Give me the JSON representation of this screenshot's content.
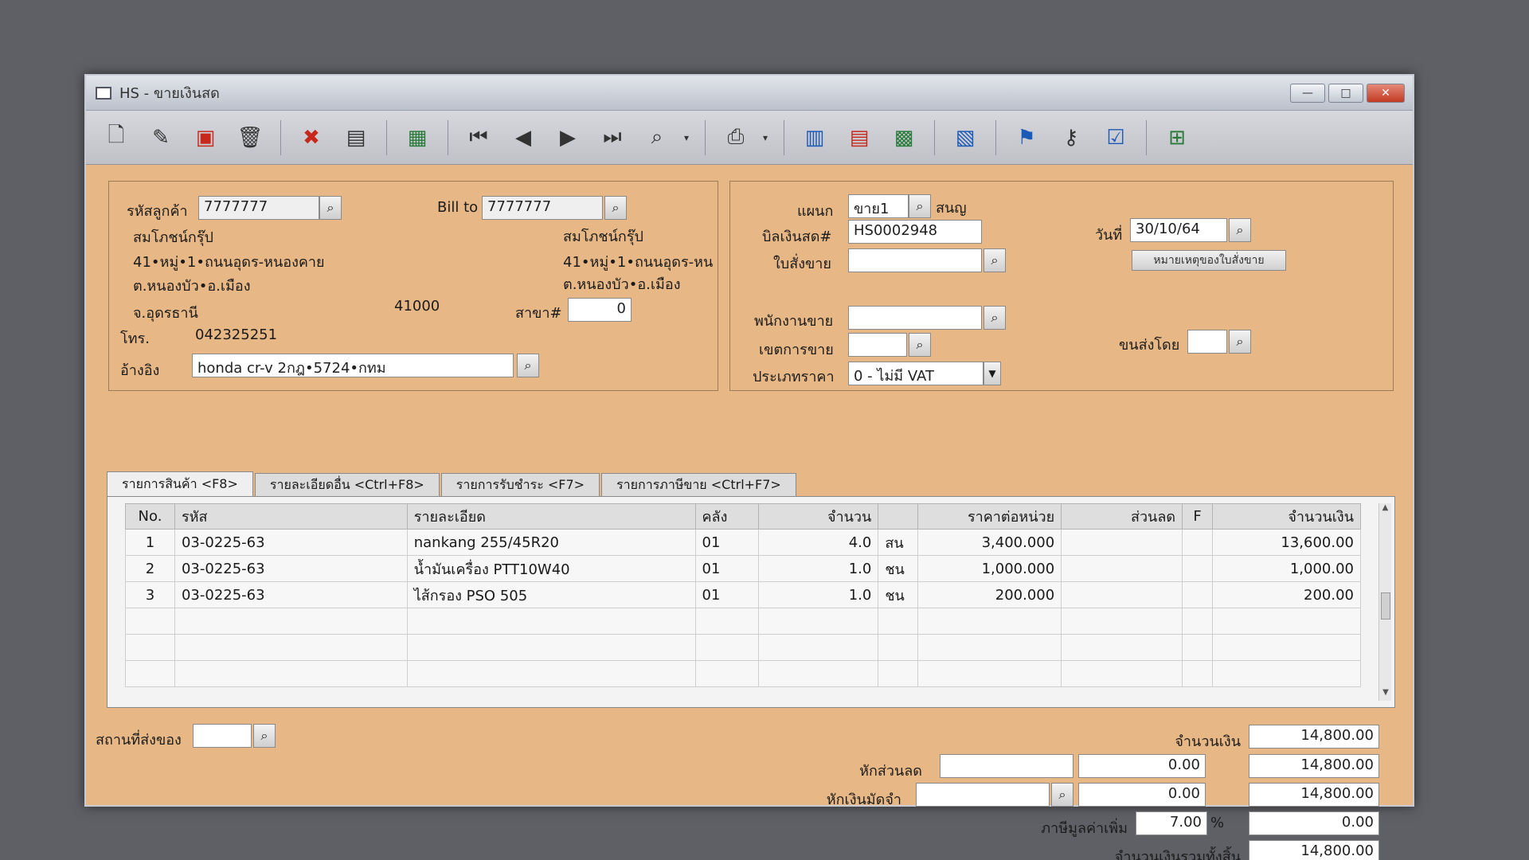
{
  "window": {
    "title": "HS - ขายเงินสด"
  },
  "window_controls": {
    "minimize": "—",
    "maximize": "□",
    "close": "✕"
  },
  "customer": {
    "code_label": "รหัสลูกค้า",
    "code": "7777777",
    "name": "สมโภชน์กรุ๊ป",
    "address1": "41•หมู่•1•ถนนอุดร-หนองคาย",
    "address2": "ต.หนองบัว•อ.เมือง",
    "address3": "จ.อุดรธานี",
    "postcode": "41000",
    "phone_label": "โทร.",
    "phone": "042325251",
    "ref_label": "อ้างอิง",
    "ref": "honda cr-v 2กฎ•5724•กทม"
  },
  "bill_to": {
    "label": "Bill to",
    "code": "7777777",
    "name": "สมโภชน์กรุ๊ป",
    "address1": "41•หมู่•1•ถนนอุดร-หน",
    "address2": "ต.หนองบัว•อ.เมือง",
    "branch_label": "สาขา#",
    "branch": "0"
  },
  "doc": {
    "dept_label": "แผนก",
    "dept": "ขาย1",
    "dept_name": "สนญ",
    "bill_no_label": "บิลเงินสด#",
    "bill_no": "HS0002948",
    "date_label": "วันที่",
    "date": "30/10/64",
    "order_label": "ใบสั่งขาย",
    "order": "",
    "order_note_button": "หมายเหตุของใบสั่งขาย",
    "salesman_label": "พนักงานขาย",
    "salesman": "",
    "area_label": "เขตการขาย",
    "area": "",
    "ship_by_label": "ขนส่งโดย",
    "ship_by": "",
    "price_type_label": "ประเภทราคา",
    "price_type": "0 - ไม่มี VAT"
  },
  "tabs": [
    {
      "label": "รายการสินค้า <F8>"
    },
    {
      "label": "รายละเอียดอื่น <Ctrl+F8>"
    },
    {
      "label": "รายการรับชำระ <F7>"
    },
    {
      "label": "รายการภาษีขาย <Ctrl+F7>"
    }
  ],
  "grid": {
    "headers": [
      "No.",
      "รหัส",
      "รายละเอียด",
      "คลัง",
      "จำนวน",
      "",
      "ราคาต่อหน่วย",
      "ส่วนลด",
      "F",
      "จำนวนเงิน"
    ],
    "rows": [
      {
        "no": "1",
        "code": "03-0225-63",
        "desc": "nankang 255/45R20",
        "wh": "01",
        "qty": "4.0",
        "unit": "สน",
        "price": "3,400.000",
        "disc": "",
        "f": "",
        "amount": "13,600.00"
      },
      {
        "no": "2",
        "code": "03-0225-63",
        "desc": "น้ำมันเครื่อง PTT10W40",
        "wh": "01",
        "qty": "1.0",
        "unit": "ชน",
        "price": "1,000.000",
        "disc": "",
        "f": "",
        "amount": "1,000.00"
      },
      {
        "no": "3",
        "code": "03-0225-63",
        "desc": "ไส้กรอง PSO 505",
        "wh": "01",
        "qty": "1.0",
        "unit": "ชน",
        "price": "200.000",
        "disc": "",
        "f": "",
        "amount": "200.00"
      }
    ]
  },
  "footer": {
    "ship_place_label": "สถานที่ส่งของ",
    "ship_place": "",
    "amount_label": "จำนวนเงิน",
    "amount": "14,800.00",
    "discount_label": "หักส่วนลด",
    "discount_input": "",
    "discount_value": "0.00",
    "after_discount": "14,800.00",
    "deposit_label": "หักเงินมัดจำ",
    "deposit_input": "",
    "deposit_value": "0.00",
    "after_deposit": "14,800.00",
    "vat_label": "ภาษีมูลค่าเพิ่ม",
    "vat_rate": "7.00",
    "vat_pct": "%",
    "vat_amount": "0.00",
    "total_label": "จำนวนเงินรวมทั้งสิ้น",
    "total": "14,800.00"
  },
  "icons": [
    "new-doc-icon",
    "edit-icon",
    "void-icon",
    "trash-icon",
    "cancel-icon",
    "save-icon",
    "print-form-icon",
    "first-record-icon",
    "prev-record-icon",
    "next-record-icon",
    "last-record-icon",
    "search-doc-icon",
    "printer-icon",
    "calculator-icon",
    "report-icon",
    "so-icon",
    "regional-icon",
    "approve-icon",
    "key-icon",
    "ok-doc-icon",
    "network-icon"
  ]
}
